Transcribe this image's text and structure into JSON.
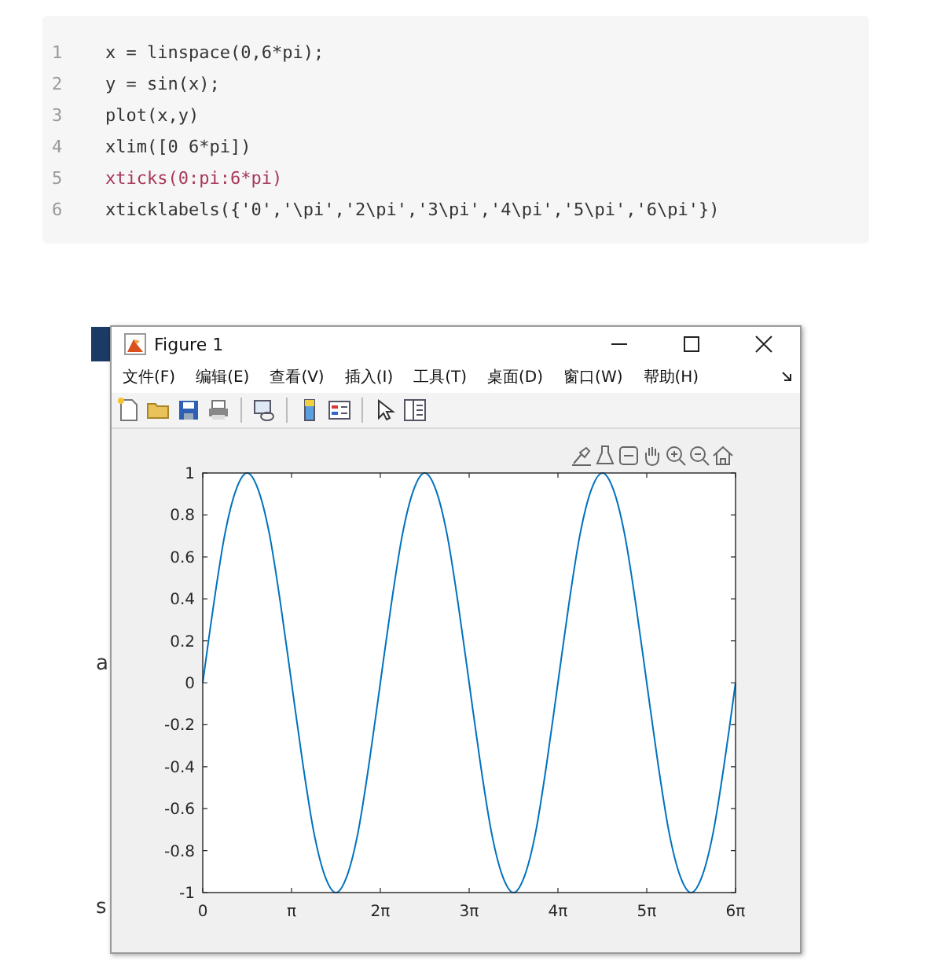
{
  "code_block": {
    "lines": [
      {
        "number": "1",
        "text": "x = linspace(0,6*pi);",
        "color": "#333333"
      },
      {
        "number": "2",
        "text": "y = sin(x);",
        "color": "#333333"
      },
      {
        "number": "3",
        "text": "plot(x,y)",
        "color": "#333333"
      },
      {
        "number": "4",
        "text": "xlim([0 6*pi])",
        "color": "#333333"
      },
      {
        "number": "5",
        "text": "xticks(0:pi:6*pi)",
        "color": "#a8385a"
      },
      {
        "number": "6",
        "text": "xticklabels({'0','\\pi','2\\pi','3\\pi','4\\pi','5\\pi','6\\pi'})",
        "color": "#333333"
      }
    ]
  },
  "background_window": {
    "fragments": [
      "a",
      "s"
    ]
  },
  "figure_window": {
    "title": "Figure 1",
    "menu": [
      "文件(F)",
      "编辑(E)",
      "查看(V)",
      "插入(I)",
      "工具(T)",
      "桌面(D)",
      "窗口(W)",
      "帮助(H)"
    ],
    "chart_data": {
      "type": "line",
      "xlim": [
        0,
        18.8496
      ],
      "ylim": [
        -1,
        1
      ],
      "xticks": [
        {
          "value": 0,
          "label": "0"
        },
        {
          "value": 3.1416,
          "label": "π"
        },
        {
          "value": 6.2832,
          "label": "2π"
        },
        {
          "value": 9.4248,
          "label": "3π"
        },
        {
          "value": 12.5664,
          "label": "4π"
        },
        {
          "value": 15.708,
          "label": "5π"
        },
        {
          "value": 18.8496,
          "label": "6π"
        }
      ],
      "yticks": [
        -1,
        -0.8,
        -0.6,
        -0.4,
        -0.2,
        0,
        0.2,
        0.4,
        0.6,
        0.8,
        1
      ],
      "x": [
        0,
        0.3927,
        0.7854,
        1.1781,
        1.5708,
        1.9635,
        2.3562,
        2.7489,
        3.1416,
        3.5343,
        3.927,
        4.3197,
        4.7124,
        5.1051,
        5.4978,
        5.8905,
        6.2832,
        6.6759,
        7.0686,
        7.4613,
        7.854,
        8.2467,
        8.6394,
        9.0321,
        9.4248,
        9.8175,
        10.2102,
        10.6029,
        10.9956,
        11.3883,
        11.781,
        12.1737,
        12.5664,
        12.9591,
        13.3518,
        13.7445,
        14.1372,
        14.5299,
        14.9226,
        15.3153,
        15.708,
        16.1007,
        16.4934,
        16.8861,
        17.2788,
        17.6715,
        18.0642,
        18.4569,
        18.8496
      ],
      "series": [
        {
          "color": "#0072bd",
          "values": [
            0,
            0.38,
            0.71,
            0.92,
            1,
            0.92,
            0.71,
            0.38,
            0,
            -0.38,
            -0.71,
            -0.92,
            -1,
            -0.92,
            -0.71,
            -0.38,
            0,
            0.38,
            0.71,
            0.92,
            1,
            0.92,
            0.71,
            0.38,
            0,
            -0.38,
            -0.71,
            -0.92,
            -1,
            -0.92,
            -0.71,
            -0.38,
            0,
            0.38,
            0.71,
            0.92,
            1,
            0.92,
            0.71,
            0.38,
            0,
            -0.38,
            -0.71,
            -0.92,
            -1,
            -0.92,
            -0.71,
            -0.38,
            0
          ]
        }
      ]
    }
  }
}
